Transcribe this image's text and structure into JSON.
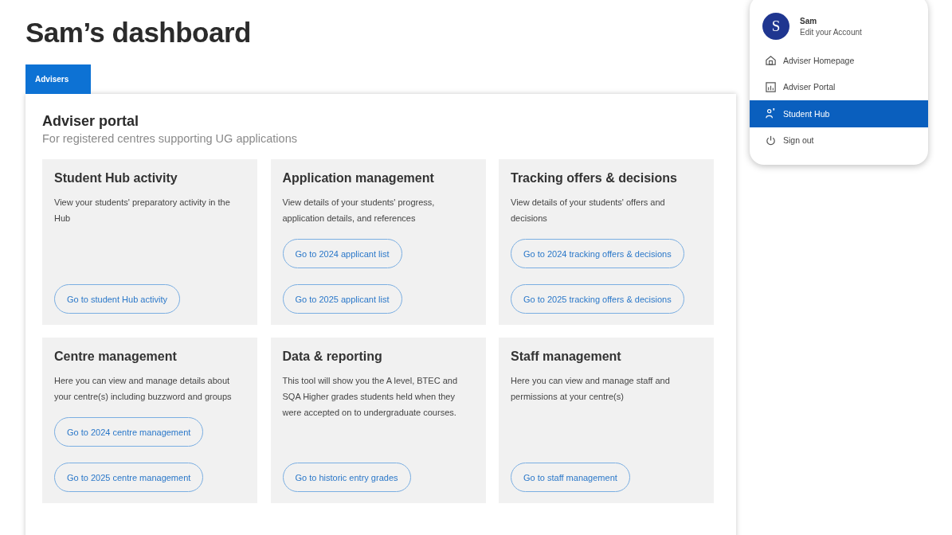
{
  "page_title": "Sam’s dashboard",
  "tabs": [
    {
      "label": "Advisers",
      "selected": true
    }
  ],
  "portal": {
    "title": "Adviser portal",
    "subtitle": "For registered centres supporting UG applications"
  },
  "cards": [
    {
      "title": "Student Hub activity",
      "description": "View your students' preparatory activity in the Hub",
      "buttons": [
        "Go to student Hub activity"
      ]
    },
    {
      "title": "Application management",
      "description": "View details of your students' progress, application details, and references",
      "buttons": [
        "Go to 2024 applicant list",
        "Go to 2025 applicant list"
      ]
    },
    {
      "title": "Tracking offers & decisions",
      "description": "View details of your students' offers and decisions",
      "buttons": [
        "Go to 2024 tracking offers & decisions",
        "Go to 2025 tracking offers & decisions"
      ]
    },
    {
      "title": "Centre management",
      "description": "Here you can view and manage details about your centre(s) including buzzword and groups",
      "buttons": [
        "Go to 2024 centre management",
        "Go to 2025 centre management"
      ]
    },
    {
      "title": "Data & reporting",
      "description": "This tool will show you the A level, BTEC and SQA Higher grades students held when they were accepted on to undergraduate courses.",
      "buttons": [
        "Go to historic entry grades"
      ]
    },
    {
      "title": "Staff management",
      "description": "Here you can view and manage staff and permissions at your centre(s)",
      "buttons": [
        "Go to staff management"
      ]
    }
  ],
  "account_menu": {
    "avatar_initial": "S",
    "name": "Sam",
    "edit_link": "Edit your Account",
    "items": [
      {
        "kind": "home",
        "label": "Adviser Homepage",
        "selected": false
      },
      {
        "kind": "portal",
        "label": "Adviser Portal",
        "selected": false
      },
      {
        "kind": "student",
        "label": "Student Hub",
        "selected": true
      },
      {
        "kind": "signout",
        "label": "Sign out",
        "selected": false
      }
    ]
  }
}
